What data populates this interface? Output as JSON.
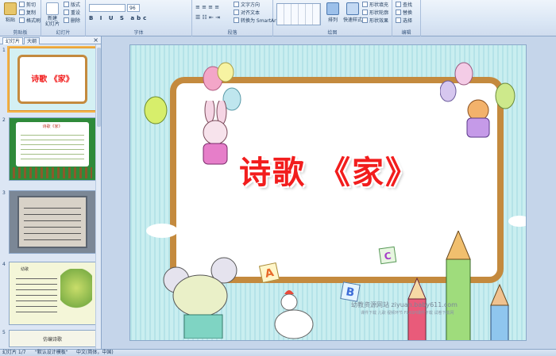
{
  "ribbon": {
    "clipboard": {
      "label": "剪贴板",
      "paste": "粘贴",
      "cut": "剪切",
      "copy": "复制",
      "format_painter": "格式刷"
    },
    "slides": {
      "label": "幻灯片",
      "new_slide": "新建\n幻灯片",
      "layout": "版式",
      "reset": "重设",
      "delete": "删除"
    },
    "font": {
      "label": "字体",
      "size": "96",
      "format_buttons": "B I U S abc"
    },
    "paragraph": {
      "label": "段落",
      "text_direction": "文字方向",
      "align_text": "对齐文本",
      "smartart": "转换为 SmartArt"
    },
    "drawing": {
      "label": "绘图",
      "arrange": "排列",
      "quick_styles": "快速样式",
      "shape_fill": "形状填充",
      "shape_outline": "形状轮廓",
      "shape_effects": "形状效果"
    },
    "editing": {
      "label": "编辑",
      "find": "查找",
      "replace": "替换",
      "select": "选择"
    }
  },
  "pane": {
    "tab_slides": "幻灯片",
    "tab_outline": "大纲",
    "close": "×",
    "thumbnails": [
      {
        "num": "1",
        "title": "诗歌 《家》"
      },
      {
        "num": "2",
        "title": "诗歌《家》"
      },
      {
        "num": "3"
      },
      {
        "num": "4",
        "title": "幼歌"
      },
      {
        "num": "5",
        "title": "仿编诗歌"
      }
    ]
  },
  "slide": {
    "title": "诗歌 《家》",
    "watermark": "幼教资源网站 ziyuan.baby611.com",
    "watermark_sub": "课件下载  儿歌  视频环节  FLASH课件下载  试卷下载网",
    "letters": {
      "a": "A",
      "b": "B",
      "c": "C"
    }
  },
  "status": {
    "slide_count": "幻灯片 1/7",
    "theme": "\"默认设计模板\"",
    "language": "中文(简体，中国)"
  },
  "colors": {
    "title_red": "#f21d1d",
    "frame_brown": "#c48a3e",
    "slide_bg": "#cfeff3",
    "selected_thumb": "#f4b54b"
  }
}
